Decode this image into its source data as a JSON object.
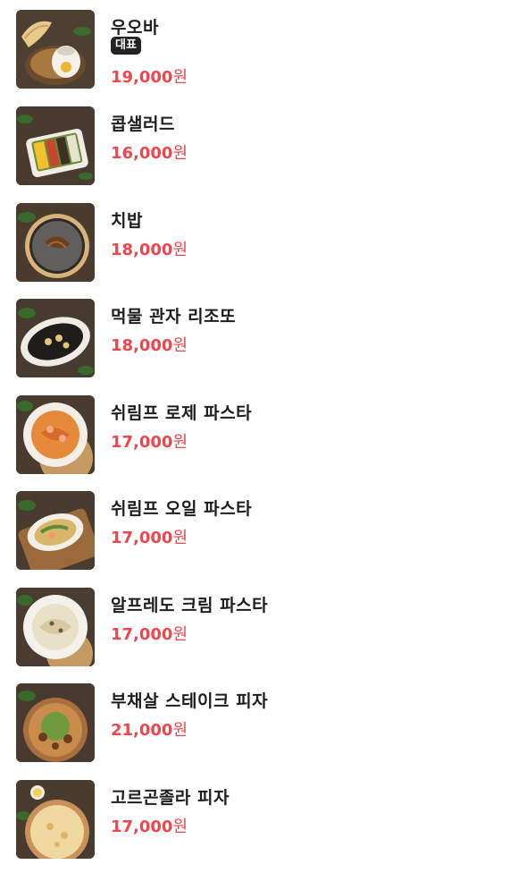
{
  "menu": {
    "items": [
      {
        "name": "우오바",
        "badge": "대표",
        "price": "19,000",
        "unit": "원",
        "photo": "egg-bread-bowl"
      },
      {
        "name": "콥샐러드",
        "price": "16,000",
        "unit": "원",
        "photo": "cobb-salad"
      },
      {
        "name": "치밥",
        "price": "18,000",
        "unit": "원",
        "photo": "cheese-rice-plate"
      },
      {
        "name": "먹물 관자 리조또",
        "price": "18,000",
        "unit": "원",
        "photo": "squid-ink-risotto"
      },
      {
        "name": "쉬림프 로제 파스타",
        "price": "17,000",
        "unit": "원",
        "photo": "rose-pasta"
      },
      {
        "name": "쉬림프 오일 파스타",
        "price": "17,000",
        "unit": "원",
        "photo": "oil-pasta"
      },
      {
        "name": "알프레도 크림 파스타",
        "price": "17,000",
        "unit": "원",
        "photo": "cream-pasta"
      },
      {
        "name": "부채살 스테이크 피자",
        "price": "21,000",
        "unit": "원",
        "photo": "steak-pizza"
      },
      {
        "name": "고르곤졸라 피자",
        "price": "17,000",
        "unit": "원",
        "photo": "gorgonzola-pizza"
      }
    ]
  },
  "colors": {
    "price": "#f0454d",
    "badge_bg": "#232323",
    "name": "#1d1d1d"
  }
}
